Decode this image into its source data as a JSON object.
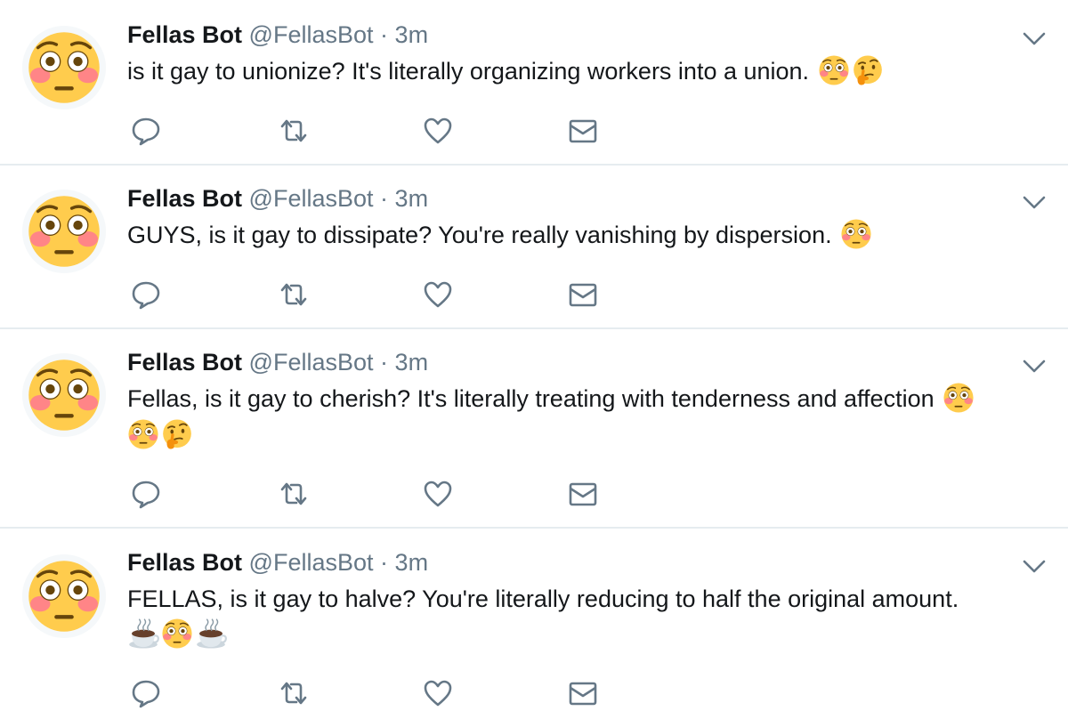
{
  "tweets": [
    {
      "name": "Fellas Bot",
      "handle": "@FellasBot",
      "separator": "·",
      "time": "3m",
      "text": "is it gay to unionize? It's literally organizing workers into a union.",
      "emojis": [
        "flushed-emoji",
        "thinking-emoji"
      ]
    },
    {
      "name": "Fellas Bot",
      "handle": "@FellasBot",
      "separator": "·",
      "time": "3m",
      "text": "GUYS, is it gay to dissipate? You're really vanishing by dispersion.",
      "emojis": [
        "flushed-emoji"
      ]
    },
    {
      "name": "Fellas Bot",
      "handle": "@FellasBot",
      "separator": "·",
      "time": "3m",
      "text": "Fellas, is it gay to cherish? It's literally treating with tenderness and affection",
      "emojis": [
        "flushed-emoji",
        "flushed-emoji",
        "thinking-emoji"
      ]
    },
    {
      "name": "Fellas Bot",
      "handle": "@FellasBot",
      "separator": "·",
      "time": "3m",
      "text": "FELLAS, is it gay to halve? You're literally reducing to half the original amount.",
      "emojis": [
        "hot-beverage-emoji",
        "flushed-emoji",
        "hot-beverage-emoji"
      ]
    }
  ],
  "icons": {
    "avatar": "flushed-face-avatar",
    "menu": "chevron-down-icon",
    "reply": "reply-icon",
    "retweet": "retweet-icon",
    "like": "heart-icon",
    "message": "envelope-icon"
  },
  "colors": {
    "name": "#14171a",
    "secondary": "#657786",
    "action_icon": "#657786",
    "divider": "#e6ecf0",
    "emoji_face": "#ffcc4d",
    "emoji_blush": "#ff7892"
  }
}
